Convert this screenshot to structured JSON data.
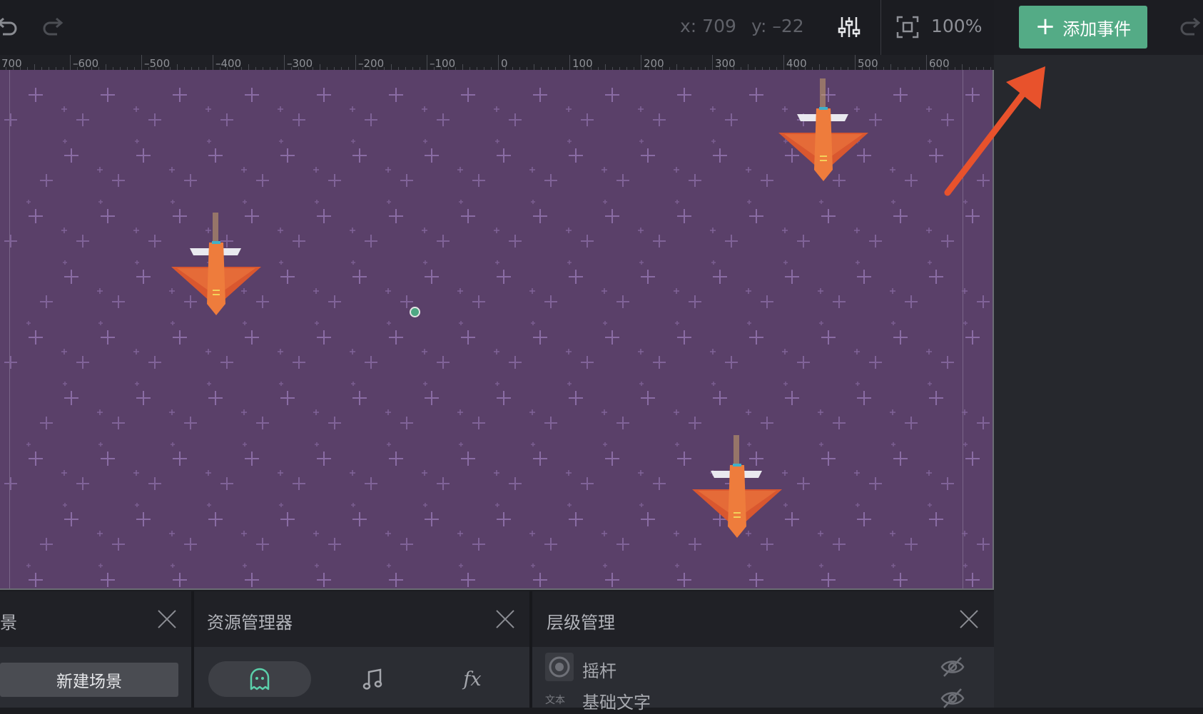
{
  "toolbar": {
    "undo_icon": "undo-icon",
    "redo_icon": "redo-icon",
    "cursor_x": "x: 709",
    "cursor_y": "y: –22",
    "settings_icon": "sliders-icon",
    "fit_icon": "fit-screen-icon",
    "zoom": "100%"
  },
  "ruler": {
    "labels": [
      "700",
      "–600",
      "–500",
      "–400",
      "–300",
      "–200",
      "–100",
      "0",
      "100",
      "200",
      "300",
      "400",
      "500",
      "600"
    ]
  },
  "stage": {
    "background": "#5a4069",
    "sprites": [
      "plane-sprite",
      "plane-sprite",
      "plane-sprite"
    ],
    "origin_marker": "origin-point"
  },
  "right_panel": {
    "add_event_label": "添加事件",
    "accent": "#54ab86",
    "annotation": "arrow-annotation"
  },
  "panels": {
    "scenes": {
      "title": "场景",
      "new_scene": "新建场景"
    },
    "resources": {
      "title": "资源管理器",
      "tab_fx": "fx"
    },
    "layers": {
      "title": "层级管理",
      "items": [
        {
          "label": "摇杆",
          "icon_text": ""
        },
        {
          "label": "基础文字",
          "icon_text": "文本"
        }
      ]
    }
  }
}
